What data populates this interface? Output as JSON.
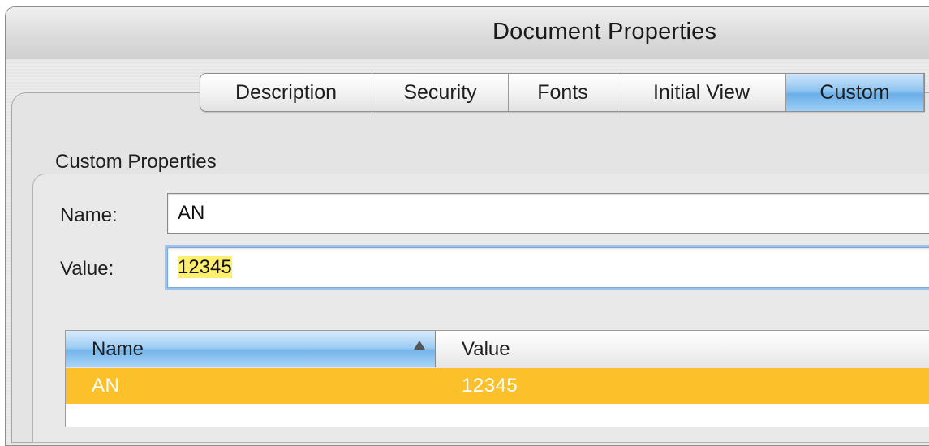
{
  "window": {
    "title": "Document Properties"
  },
  "tabs": [
    {
      "label": "Description",
      "selected": false
    },
    {
      "label": "Security",
      "selected": false
    },
    {
      "label": "Fonts",
      "selected": false
    },
    {
      "label": "Initial View",
      "selected": false
    },
    {
      "label": "Custom",
      "selected": true
    }
  ],
  "custom_properties": {
    "section_label": "Custom Properties",
    "name_label": "Name:",
    "name_value": "AN",
    "value_label": "Value:",
    "value_value": "12345"
  },
  "table": {
    "columns": [
      "Name",
      "Value"
    ],
    "sort_column": "Name",
    "sort_direction": "ascending",
    "rows": [
      {
        "name": "AN",
        "value": "12345",
        "selected": true
      }
    ]
  },
  "colors": {
    "selected_tab": "#8fc4f1",
    "selected_row": "#fcc02a",
    "text_highlight": "#ffef6e",
    "focus_ring": "#9cc4ec"
  }
}
